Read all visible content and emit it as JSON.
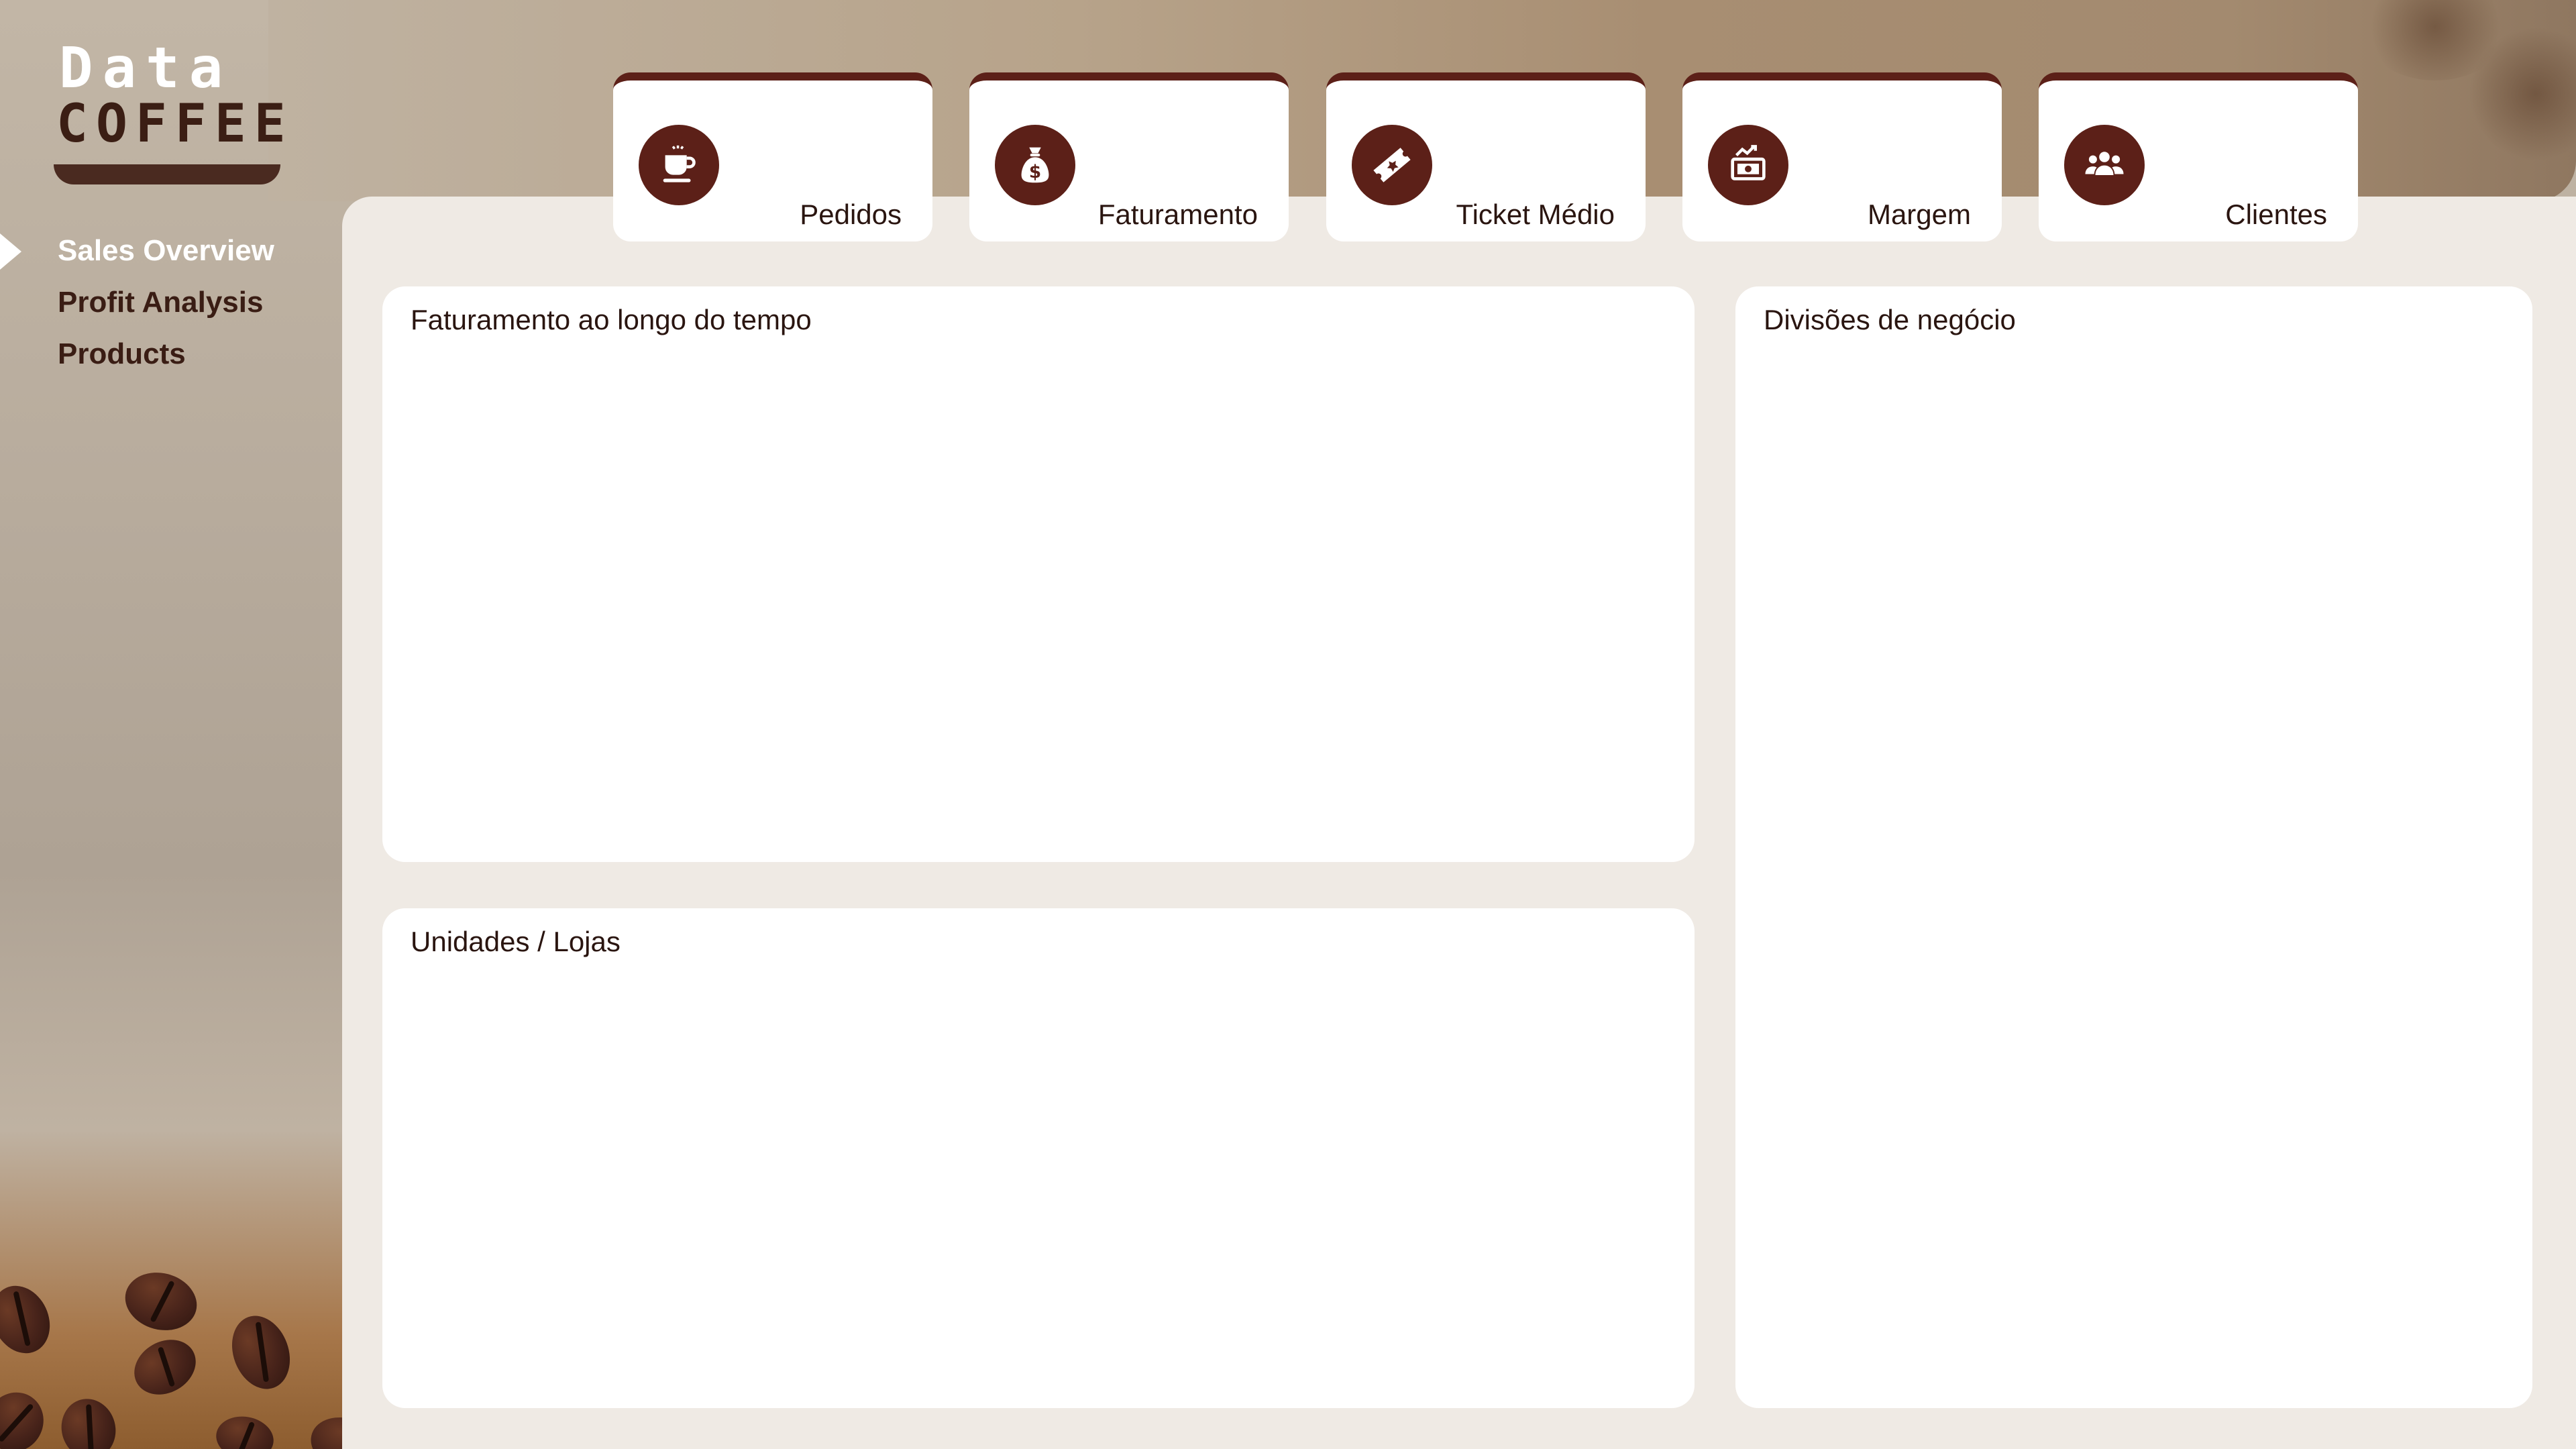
{
  "brand": {
    "line1": "Data",
    "line2": "COFFEE"
  },
  "sidebar": {
    "items": [
      {
        "label": "Sales Overview",
        "active": true
      },
      {
        "label": "Profit Analysis",
        "active": false
      },
      {
        "label": "Products",
        "active": false
      }
    ]
  },
  "kpis": [
    {
      "label": "Pedidos",
      "icon": "coffee-cup-icon"
    },
    {
      "label": "Faturamento",
      "icon": "money-bag-icon"
    },
    {
      "label": "Ticket Médio",
      "icon": "ticket-icon"
    },
    {
      "label": "Margem",
      "icon": "cash-growth-icon"
    },
    {
      "label": "Clientes",
      "icon": "users-icon"
    }
  ],
  "panels": {
    "revenue_over_time": {
      "title": "Faturamento ao longo do tempo"
    },
    "business_divisions": {
      "title": "Divisões de negócio"
    },
    "stores": {
      "title": "Unidades / Lojas"
    }
  },
  "colors": {
    "accent": "#5c2018",
    "panel_bg": "#efeae4",
    "card_bg": "#ffffff",
    "text_dark": "#2a1510"
  }
}
